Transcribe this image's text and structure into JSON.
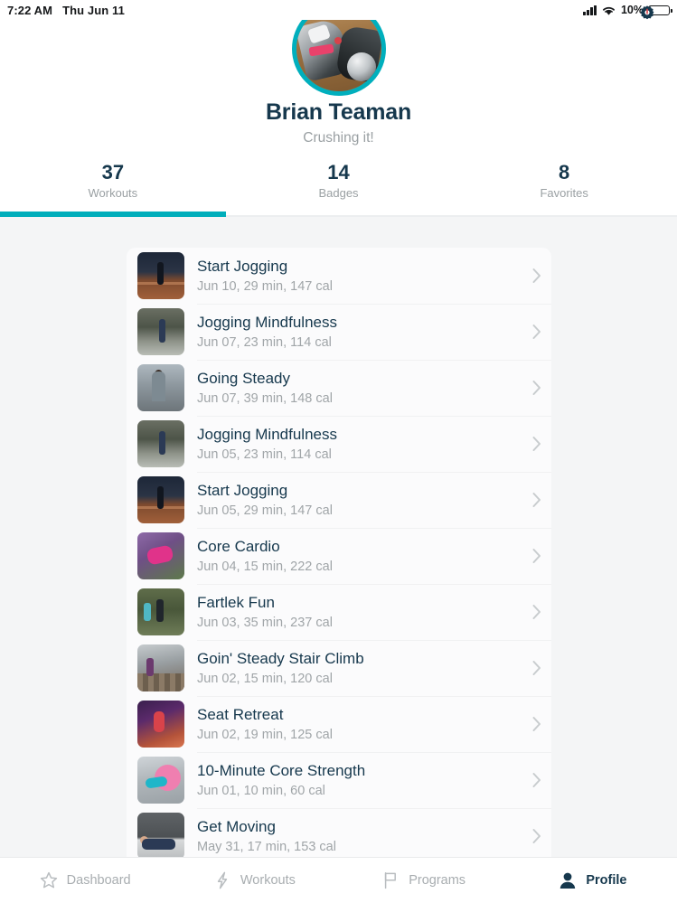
{
  "status_bar": {
    "time": "7:22 AM",
    "date": "Thu Jun 11",
    "battery_percent": "10%",
    "icons": [
      "signal-bars-icon",
      "wifi-icon",
      "battery-icon",
      "gear-icon"
    ]
  },
  "profile": {
    "name": "Brian Teaman",
    "tagline": "Crushing it!",
    "avatar_alt": "avatar",
    "accent_color": "#00afbd"
  },
  "stats": [
    {
      "value": "37",
      "label": "Workouts",
      "active": true
    },
    {
      "value": "14",
      "label": "Badges",
      "active": false
    },
    {
      "value": "8",
      "label": "Favorites",
      "active": false
    }
  ],
  "workouts": [
    {
      "title": "Start Jogging",
      "meta": "Jun 10, 29 min, 147 cal",
      "date": "Jun 10",
      "duration": "29 min",
      "calories": "147 cal",
      "thumb": "t-jog-night"
    },
    {
      "title": "Jogging Mindfulness",
      "meta": "Jun 07, 23 min, 114 cal",
      "date": "Jun 07",
      "duration": "23 min",
      "calories": "114 cal",
      "thumb": "t-jog-path"
    },
    {
      "title": "Going Steady",
      "meta": "Jun 07, 39 min, 148 cal",
      "date": "Jun 07",
      "duration": "39 min",
      "calories": "148 cal",
      "thumb": "t-steady"
    },
    {
      "title": "Jogging Mindfulness",
      "meta": "Jun 05, 23 min, 114 cal",
      "date": "Jun 05",
      "duration": "23 min",
      "calories": "114 cal",
      "thumb": "t-jog-path"
    },
    {
      "title": "Start Jogging",
      "meta": "Jun 05, 29 min, 147 cal",
      "date": "Jun 05",
      "duration": "29 min",
      "calories": "147 cal",
      "thumb": "t-jog-night"
    },
    {
      "title": "Core Cardio",
      "meta": "Jun 04, 15 min, 222 cal",
      "date": "Jun 04",
      "duration": "15 min",
      "calories": "222 cal",
      "thumb": "t-core-cardio"
    },
    {
      "title": "Fartlek Fun",
      "meta": "Jun 03, 35 min, 237 cal",
      "date": "Jun 03",
      "duration": "35 min",
      "calories": "237 cal",
      "thumb": "t-fartlek"
    },
    {
      "title": "Goin' Steady Stair Climb",
      "meta": "Jun 02, 15 min, 120 cal",
      "date": "Jun 02",
      "duration": "15 min",
      "calories": "120 cal",
      "thumb": "t-stairs"
    },
    {
      "title": "Seat Retreat",
      "meta": "Jun 02, 19 min, 125 cal",
      "date": "Jun 02",
      "duration": "19 min",
      "calories": "125 cal",
      "thumb": "t-seat"
    },
    {
      "title": "10-Minute Core Strength",
      "meta": "Jun 01, 10 min, 60 cal",
      "date": "Jun 01",
      "duration": "10 min",
      "calories": "60 cal",
      "thumb": "t-core10"
    },
    {
      "title": "Get Moving",
      "meta": "May 31, 17 min, 153 cal",
      "date": "May 31",
      "duration": "17 min",
      "calories": "153 cal",
      "thumb": "t-getmoving"
    }
  ],
  "bottom_nav": [
    {
      "label": "Dashboard",
      "icon": "star-icon",
      "active": false
    },
    {
      "label": "Workouts",
      "icon": "lightning-bolt-icon",
      "active": false
    },
    {
      "label": "Programs",
      "icon": "flag-icon",
      "active": false
    },
    {
      "label": "Profile",
      "icon": "person-icon",
      "active": true
    }
  ]
}
